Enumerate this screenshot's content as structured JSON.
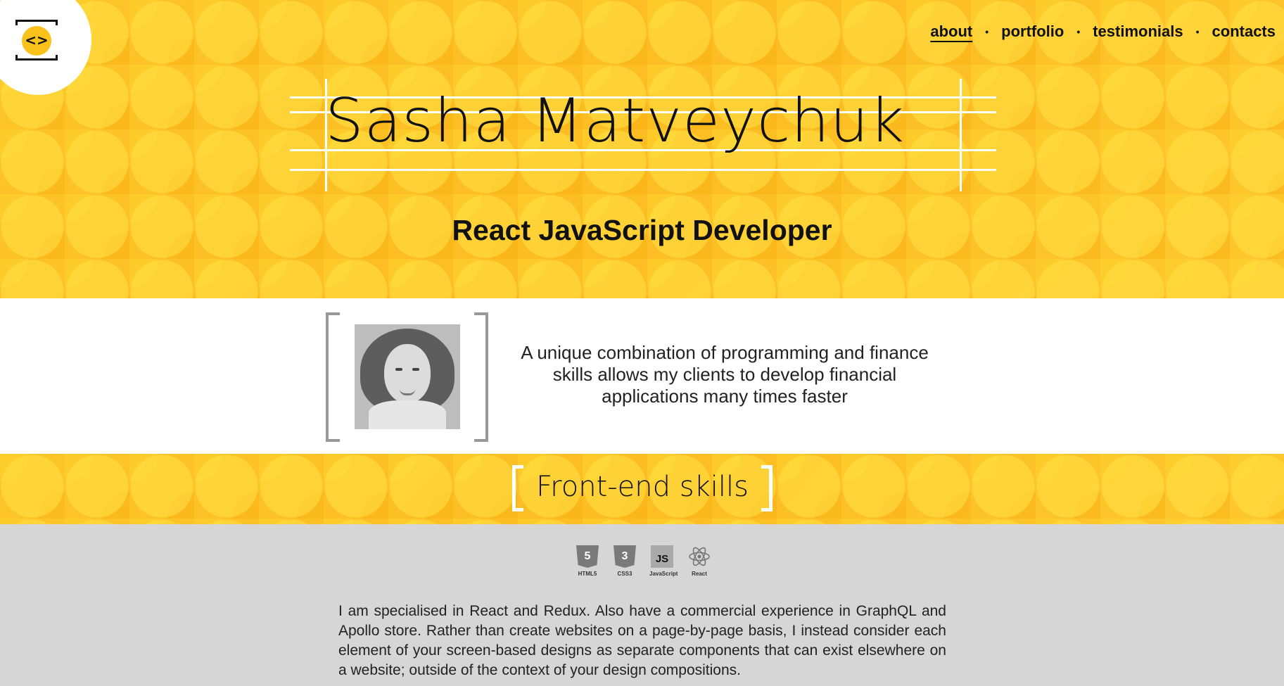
{
  "header": {
    "logo_glyph": "<>",
    "nav": [
      {
        "label": "about",
        "active": true
      },
      {
        "label": "portfolio",
        "active": false
      },
      {
        "label": "testimonials",
        "active": false
      },
      {
        "label": "contacts",
        "active": false
      }
    ],
    "nav_separator": "•"
  },
  "hero": {
    "name": "Sasha Matveychuk",
    "role": "React JavaScript Developer"
  },
  "about": {
    "photo_alt": "portrait photo",
    "intro": "A unique combination of programming and finance skills allows my clients to develop financial applications many times faster"
  },
  "skills": {
    "title": "Front-end skills",
    "icons": [
      {
        "name": "html5-icon",
        "glyph": "5",
        "label": "HTML5"
      },
      {
        "name": "css3-icon",
        "glyph": "3",
        "label": "CSS3"
      },
      {
        "name": "javascript-icon",
        "glyph": "JS",
        "label": "JavaScript"
      },
      {
        "name": "react-icon",
        "glyph": "⚛",
        "label": "React"
      }
    ],
    "bio": "I am specialised in React and Redux. Also have a commercial experience in GraphQL and Apollo store. Rather than create websites on a page-by-page basis, I instead consider each element of your screen-based designs as separate components that can exist elsewhere on a website; outside of the context of your design compositions."
  },
  "colors": {
    "accent": "#fcc21c",
    "gray_band": "#d6d6d6"
  }
}
